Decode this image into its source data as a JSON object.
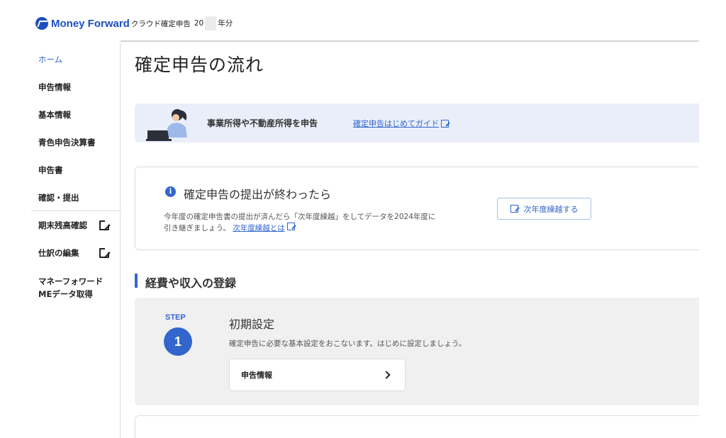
{
  "header": {
    "brand": "Money Forward",
    "app_name": "クラウド確定申告",
    "year_prefix": "20",
    "year_suffix": "年分"
  },
  "sidebar": {
    "items": [
      {
        "label": "ホーム",
        "active": true,
        "external": false
      },
      {
        "label": "申告情報",
        "active": false,
        "external": false
      },
      {
        "label": "基本情報",
        "active": false,
        "external": false
      },
      {
        "label": "青色申告決算書",
        "active": false,
        "external": false
      },
      {
        "label": "申告書",
        "active": false,
        "external": false
      },
      {
        "label": "確認・提出",
        "active": false,
        "external": false
      },
      {
        "label": "期末残高確認",
        "active": false,
        "external": true
      },
      {
        "label": "仕訳の編集",
        "active": false,
        "external": true
      }
    ],
    "multiline_item": {
      "line1": "マネーフォワード",
      "line2": "MEデータ取得"
    }
  },
  "main": {
    "title": "確定申告の流れ",
    "banner": {
      "text": "事業所得や不動産所得を申告",
      "link": "確定申告はじめてガイド"
    },
    "notice": {
      "title": "確定申告の提出が終わったら",
      "desc_line1": "今年度の確定申告書の提出が済んだら「次年度繰越」をしてデータを2024年度に",
      "desc_line2": "引き継ぎましょう。",
      "desc_link": "次年度繰越とは",
      "button": "次年度繰越する"
    },
    "section": {
      "title": "経費や収入の登録"
    },
    "step": {
      "label": "STEP",
      "number": "1",
      "title": "初期設定",
      "desc": "確定申告に必要な基本設定をおこないます。はじめに設定しましょう。",
      "button": "申告情報"
    }
  },
  "colors": {
    "accent": "#3366cc",
    "brand": "#1d4fbf",
    "banner_bg": "#e9eef9",
    "step_bg": "#f0f0f0"
  }
}
